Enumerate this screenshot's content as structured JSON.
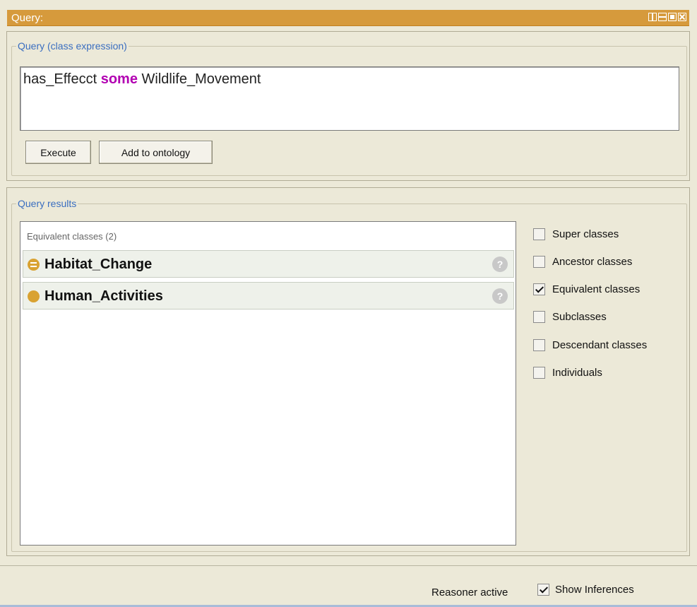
{
  "window": {
    "title": "Query:"
  },
  "query_section": {
    "legend": "Query (class expression)",
    "expression": {
      "part1": "has_Effecct",
      "keyword": "some",
      "part2": "Wildlife_Movement"
    },
    "buttons": {
      "execute": "Execute",
      "add_to_ontology": "Add to ontology"
    }
  },
  "results_section": {
    "legend": "Query results",
    "header": "Equivalent classes (2)",
    "items": [
      {
        "label": "Habitat_Change",
        "icon": "equivalent-class-icon"
      },
      {
        "label": "Human_Activities",
        "icon": "class-icon"
      }
    ],
    "help_glyph": "?",
    "options": [
      {
        "label": "Super classes",
        "checked": false
      },
      {
        "label": "Ancestor classes",
        "checked": false
      },
      {
        "label": "Equivalent classes",
        "checked": true
      },
      {
        "label": "Subclasses",
        "checked": false
      },
      {
        "label": "Descendant classes",
        "checked": false
      },
      {
        "label": "Individuals",
        "checked": false
      }
    ]
  },
  "status_bar": {
    "reasoner": "Reasoner active",
    "show_inferences": {
      "label": "Show Inferences",
      "checked": true
    }
  },
  "colors": {
    "title_bar": "#d69a3c",
    "legend_text": "#3a6ec0",
    "keyword": "#b200b2",
    "class_bullet": "#d9a232"
  }
}
